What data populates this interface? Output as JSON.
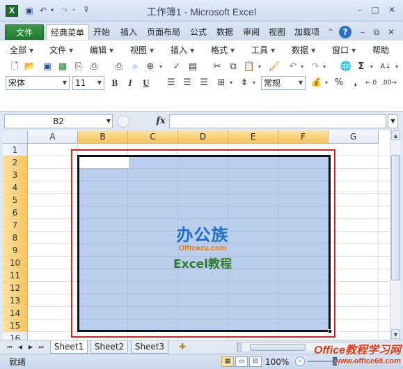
{
  "window": {
    "app_icon": "X",
    "title": "工作簿1 - Microsoft Excel",
    "controls": [
      "–",
      "□",
      "✕"
    ]
  },
  "quick_access": {
    "save_icon": "save-icon",
    "undo_icon": "undo-icon",
    "redo_icon": "redo-icon"
  },
  "tabs": [
    {
      "label": "文件"
    },
    {
      "label": "经典菜单"
    },
    {
      "label": "开始"
    },
    {
      "label": "插入"
    },
    {
      "label": "页面布局"
    },
    {
      "label": "公式"
    },
    {
      "label": "数据"
    },
    {
      "label": "审阅"
    },
    {
      "label": "视图"
    },
    {
      "label": "加载项"
    }
  ],
  "classic_menu": [
    {
      "label": "全部"
    },
    {
      "label": "文件"
    },
    {
      "label": "编辑"
    },
    {
      "label": "视图"
    },
    {
      "label": "插入"
    },
    {
      "label": "格式"
    },
    {
      "label": "工具"
    },
    {
      "label": "数据"
    },
    {
      "label": "窗口"
    },
    {
      "label": "帮助"
    }
  ],
  "format_bar": {
    "font_name": "宋体",
    "font_size": "11",
    "bold": "B",
    "italic": "I",
    "underline": "U",
    "number_format": "常规",
    "percent": "%",
    "comma": ",",
    "sigma": "Σ"
  },
  "formula_bar": {
    "name_box": "B2",
    "fx_label": "fx",
    "value": ""
  },
  "grid": {
    "columns": [
      "A",
      "B",
      "C",
      "D",
      "E",
      "F",
      "G"
    ],
    "selected_columns": [
      "B",
      "C",
      "D",
      "E",
      "F"
    ],
    "rows": [
      "1",
      "2",
      "3",
      "4",
      "5",
      "6",
      "7",
      "8",
      "9",
      "10",
      "11",
      "12",
      "13",
      "14",
      "15",
      "16"
    ],
    "selected_rows": [
      "2",
      "3",
      "4",
      "5",
      "6",
      "7",
      "8",
      "9",
      "10",
      "11",
      "12",
      "13",
      "14",
      "15"
    ],
    "selection_range": "B2:F15",
    "selection_color": "#7aa0dc"
  },
  "logo": {
    "line1": "办公族",
    "line2": "Officezu.com",
    "line3": "Excel教程"
  },
  "sheets": [
    {
      "label": "Sheet1",
      "active": true
    },
    {
      "label": "Sheet2",
      "active": false
    },
    {
      "label": "Sheet3",
      "active": false
    }
  ],
  "status": {
    "ready": "就绪",
    "zoom": "100%"
  },
  "watermark": {
    "line1": "Office教程学习网",
    "line2": "www.office68.com"
  },
  "colors": {
    "file_tab": "#2e8a3c",
    "selection_border": "#111111",
    "highlight_frame": "#d81f1f",
    "header_selected": "#f6c45c"
  }
}
